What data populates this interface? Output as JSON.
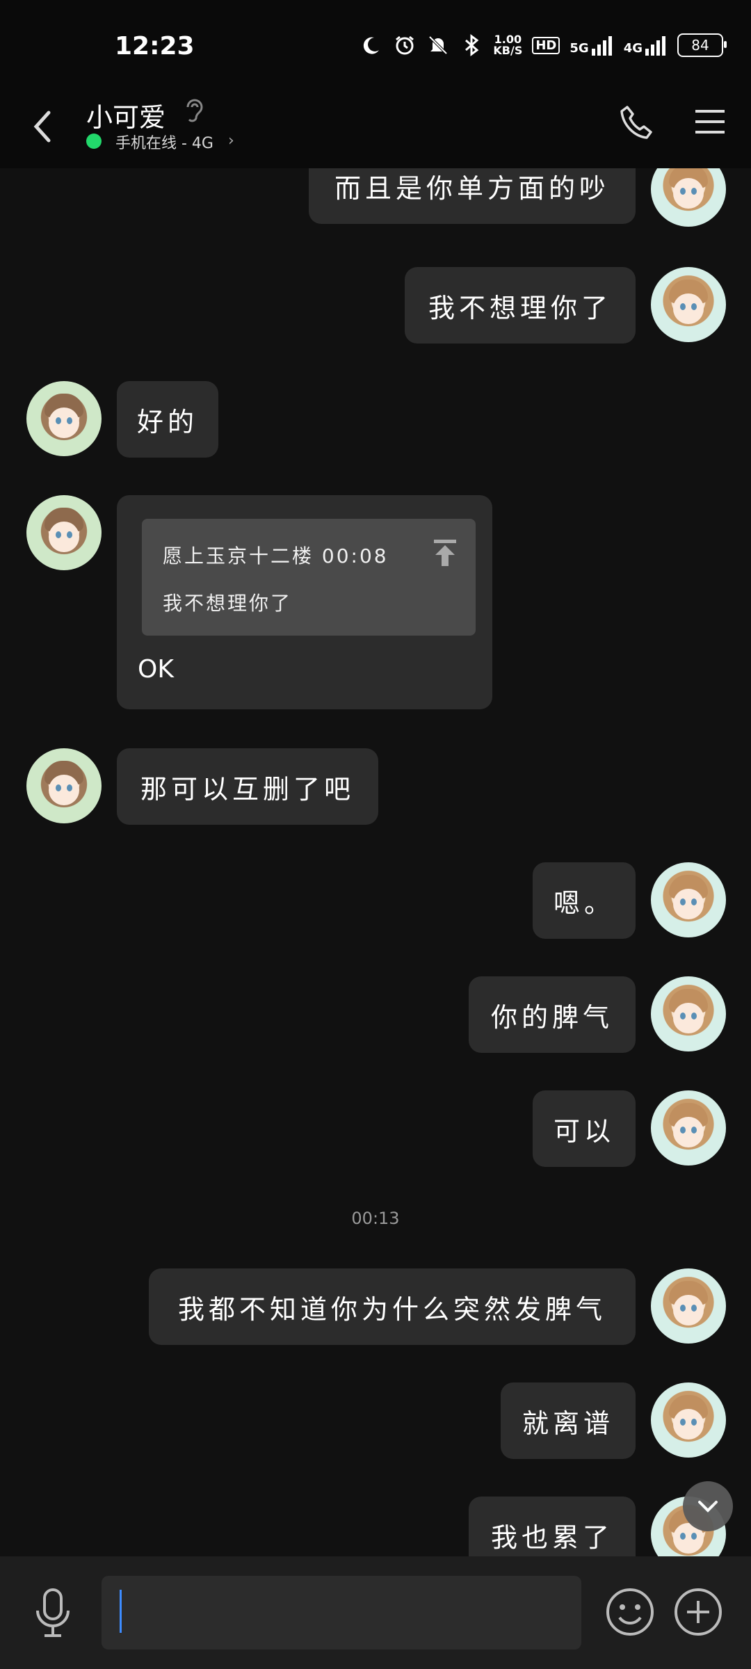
{
  "status_bar": {
    "time": "12:23",
    "net_speed_value": "1.00",
    "net_speed_unit": "KB/S",
    "hd": "HD",
    "signal1": "5G",
    "signal2": "4G",
    "battery": "84",
    "icons": [
      "moon-icon",
      "alarm-icon",
      "mute-icon",
      "bluetooth-icon",
      "hd-icon",
      "signal-5g-icon",
      "signal-4g-icon",
      "battery-icon"
    ]
  },
  "header": {
    "name": "小可爱",
    "status": "手机在线 - 4G",
    "colors": {
      "online": "#22d86b"
    },
    "icons": [
      "back-icon",
      "ear-icon",
      "phone-icon",
      "menu-icon"
    ]
  },
  "messages": [
    {
      "side": "self",
      "text": "而且是你单方面的吵"
    },
    {
      "side": "self",
      "text": "我不想理你了"
    },
    {
      "side": "other",
      "text": "好的"
    },
    {
      "side": "other",
      "type": "quote",
      "quote_author_time": "愿上玉京十二楼 00:08",
      "quote_text": "我不想理你了",
      "reply": "OK"
    },
    {
      "side": "other",
      "text": "那可以互删了吧"
    },
    {
      "side": "self",
      "text": "嗯。"
    },
    {
      "side": "self",
      "text": "你的脾气"
    },
    {
      "side": "self",
      "text": "可以"
    },
    {
      "side": "self",
      "text": "我都不知道你为什么突然发脾气"
    },
    {
      "side": "self",
      "text": "就离谱"
    },
    {
      "side": "self",
      "text": "我也累了"
    }
  ],
  "timestamp": "00:13",
  "input": {
    "value": "",
    "placeholder": ""
  },
  "bottom_icons": [
    "microphone-icon",
    "emoji-icon",
    "plus-icon",
    "scroll-down-icon"
  ]
}
